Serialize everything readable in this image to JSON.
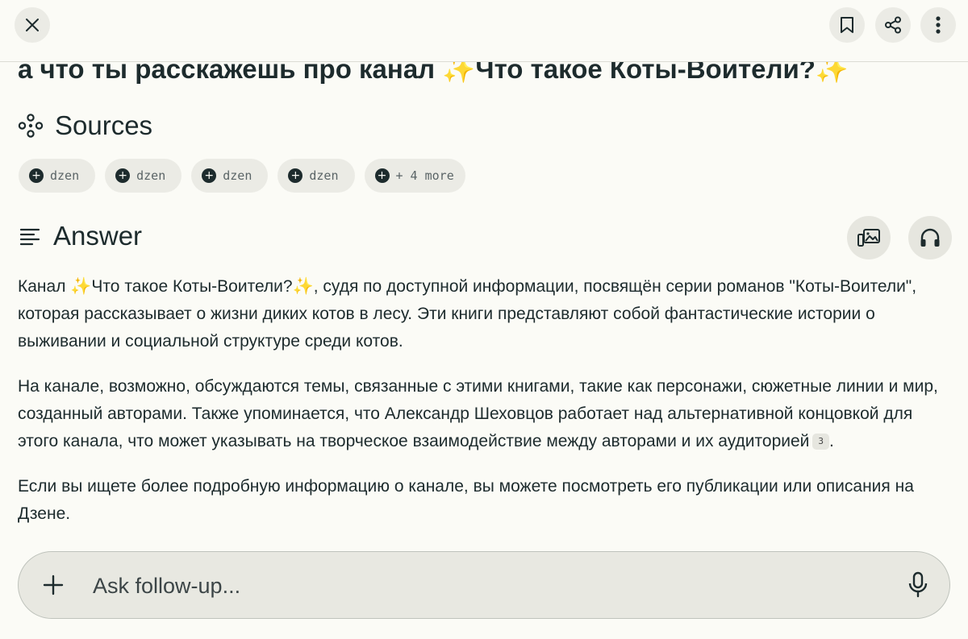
{
  "topbar": {
    "close_icon": "close-icon",
    "bookmark_icon": "bookmark-icon",
    "share_icon": "share-icon",
    "more_icon": "more-vertical-icon"
  },
  "question": "а что ты расскажешь про канал ✨Что такое Коты-Воители?✨",
  "sources": {
    "title": "Sources",
    "icon": "sources-icon",
    "chips": [
      "dzen",
      "dzen",
      "dzen",
      "dzen"
    ],
    "more_label": "+ 4 more"
  },
  "answer": {
    "title": "Answer",
    "icon": "answer-lines-icon",
    "gallery_icon": "image-gallery-icon",
    "listen_icon": "headphones-icon",
    "paragraphs": [
      "Канал ✨Что такое Коты-Воители?✨, судя по доступной информации, посвящён серии романов \"Коты-Воители\", которая рассказывает о жизни диких котов в лесу. Эти книги представляют собой фантастические истории о выживании и социальной структуре среди котов.",
      "На канале, возможно, обсуждаются темы, связанные с этими книгами, такие как персонажи, сюжетные линии и мир, созданный авторами. Также упоминается, что Александр Шеховцов работает над альтернативной концовкой для этого канала, что может указывать на творческое взаимодействие между авторами и их аудиторией",
      "Если вы ищете более подробную информацию о канале, вы можете посмотреть его публикации или описания на Дзене."
    ],
    "citation": "3",
    "after_citation": "."
  },
  "followup": {
    "placeholder": "Ask follow-up...",
    "value": "",
    "plus_icon": "plus-icon",
    "mic_icon": "microphone-icon"
  },
  "colors": {
    "background": "#fbfbf6",
    "text": "#1d2b2d",
    "chip_bg": "#ebebe5"
  }
}
